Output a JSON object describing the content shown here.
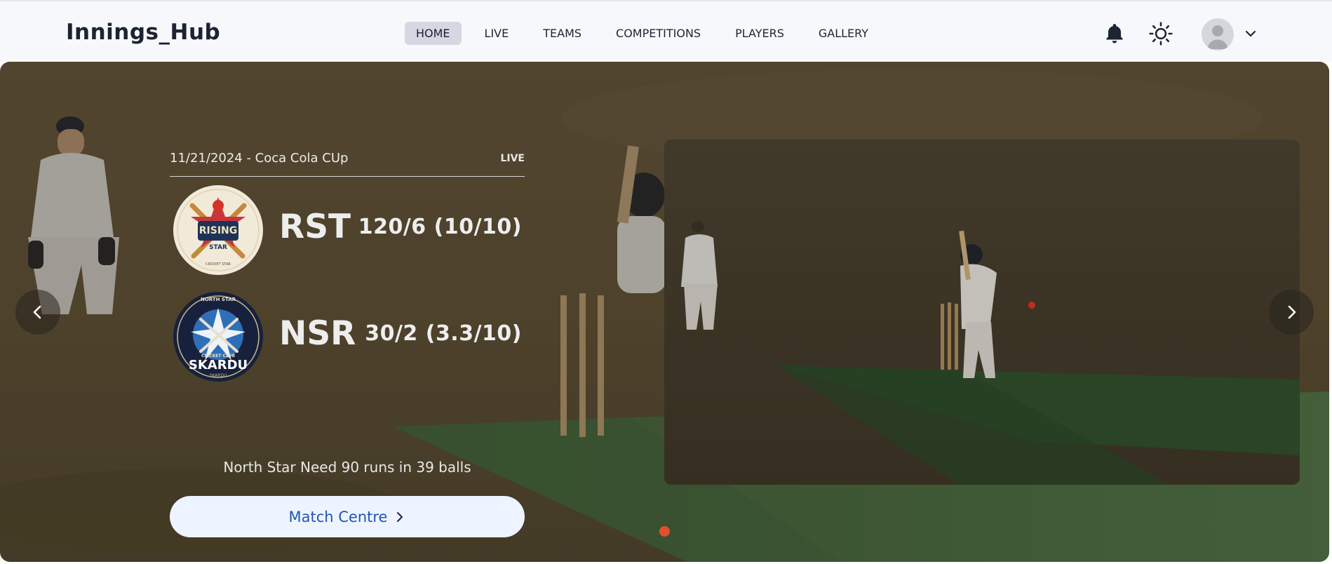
{
  "header": {
    "brand": "Innings_Hub",
    "nav": [
      {
        "label": "HOME",
        "active": true
      },
      {
        "label": "LIVE",
        "active": false
      },
      {
        "label": "TEAMS",
        "active": false
      },
      {
        "label": "COMPETITIONS",
        "active": false
      },
      {
        "label": "PLAYERS",
        "active": false
      },
      {
        "label": "GALLERY",
        "active": false
      }
    ],
    "icons": [
      "bell-icon",
      "sun-icon",
      "avatar",
      "chevron-down-icon"
    ]
  },
  "hero": {
    "meta": {
      "date_competition": "11/21/2024 - Coca Cola CUp",
      "status": "LIVE"
    },
    "teams": [
      {
        "code": "RST",
        "score": "120/6 (10/10)",
        "logo": "rising-star-logo",
        "logo_text": [
          "RISING",
          "STAR",
          "CRICKET STAR"
        ]
      },
      {
        "code": "NSR",
        "score": "30/2 (3.3/10)",
        "logo": "north-star-logo",
        "logo_text": [
          "NORTH STAR",
          "CRICKET CLUB",
          "SKARDU",
          "SKARDU"
        ]
      }
    ],
    "need": "North Star Need 90 runs in 39 balls",
    "cta": "Match Centre",
    "slides_count": 1,
    "active_slide": 1
  },
  "colors": {
    "header_bg": "#f7f8fb",
    "brand": "#1c2433",
    "active_nav_bg": "#d5d8e2",
    "cta_bg": "#eef4ff",
    "cta_text": "#1f56b8",
    "dot": "#e0502c",
    "ground": "#6e5c3e",
    "pitch": "#4f7a46"
  }
}
